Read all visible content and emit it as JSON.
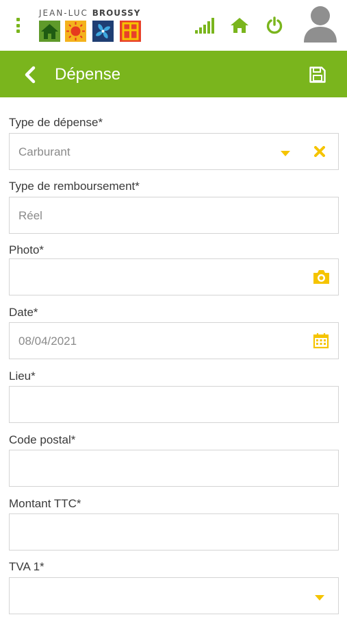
{
  "header": {
    "brand_prefix": "JEAN-LUC ",
    "brand_name": "BROUSSY",
    "icons": [
      "menu-kebab-icon",
      "signal-icon",
      "home-icon",
      "power-icon",
      "user-avatar-icon"
    ]
  },
  "titlebar": {
    "title": "Dépense",
    "back_icon": "chevron-left-icon",
    "save_icon": "floppy-disk-icon"
  },
  "form": {
    "fields": [
      {
        "label": "Type de dépense*",
        "value": "Carburant",
        "icons": [
          "caret-down-icon",
          "clear-x-icon"
        ]
      },
      {
        "label": "Type de remboursement*",
        "value": "Réel"
      },
      {
        "label": "Photo*",
        "value": "",
        "icons": [
          "camera-icon"
        ]
      },
      {
        "label": "Date*",
        "value": "08/04/2021",
        "icons": [
          "calendar-icon"
        ]
      },
      {
        "label": "Lieu*",
        "value": ""
      },
      {
        "label": "Code postal*",
        "value": ""
      },
      {
        "label": "Montant TTC*",
        "value": ""
      },
      {
        "label": "TVA 1*",
        "value": "",
        "icons": [
          "caret-down-icon"
        ]
      }
    ]
  },
  "colors": {
    "brand_green": "#7ab51d",
    "accent_yellow": "#f5c400",
    "border": "#d4d4d4"
  }
}
